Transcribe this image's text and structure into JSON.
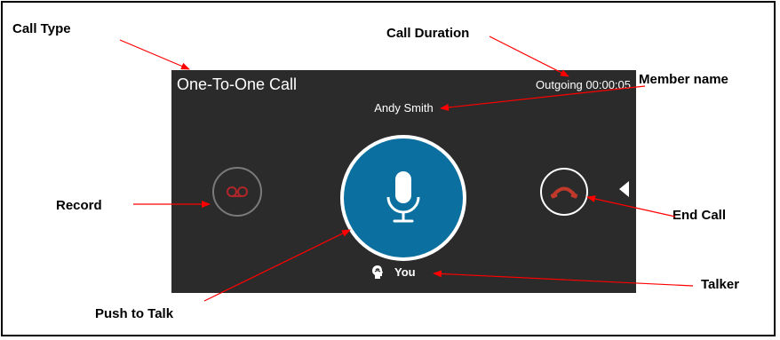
{
  "callouts": {
    "call_type": "Call Type",
    "call_duration": "Call Duration",
    "member_name": "Member name",
    "record": "Record",
    "end_call": "End Call",
    "push_to_talk": "Push to Talk",
    "talker": "Talker"
  },
  "panel": {
    "title": "One-To-One Call",
    "status": "Outgoing 00:00:05",
    "member": "Andy Smith",
    "talker_label": "You"
  },
  "icons": {
    "record": "voicemail-icon",
    "push_to_talk": "microphone-icon",
    "end_call": "hang-up-icon",
    "talker": "head-speaking-icon",
    "side": "triangle-left-icon"
  },
  "colors": {
    "panel_bg": "#2b2b2b",
    "ptt_blue": "#0b70a0",
    "record_red": "#b1262a",
    "annotation_red": "#ff0000"
  }
}
